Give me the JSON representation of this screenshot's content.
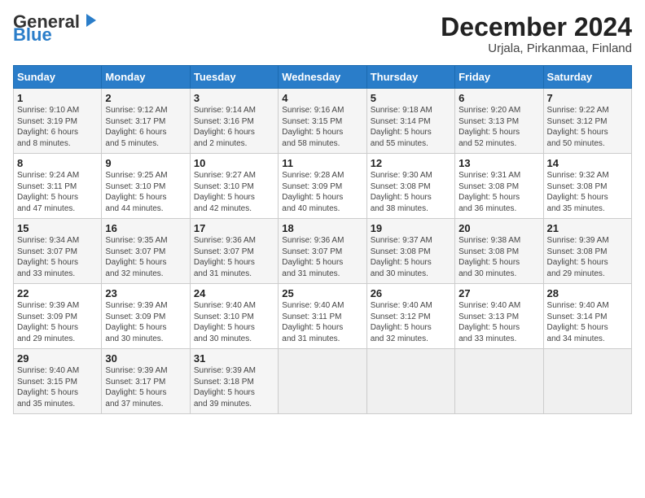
{
  "header": {
    "logo_general": "General",
    "logo_blue": "Blue",
    "title": "December 2024",
    "subtitle": "Urjala, Pirkanmaa, Finland"
  },
  "days_of_week": [
    "Sunday",
    "Monday",
    "Tuesday",
    "Wednesday",
    "Thursday",
    "Friday",
    "Saturday"
  ],
  "weeks": [
    [
      {
        "day": "1",
        "info": "Sunrise: 9:10 AM\nSunset: 3:19 PM\nDaylight: 6 hours\nand 8 minutes."
      },
      {
        "day": "2",
        "info": "Sunrise: 9:12 AM\nSunset: 3:17 PM\nDaylight: 6 hours\nand 5 minutes."
      },
      {
        "day": "3",
        "info": "Sunrise: 9:14 AM\nSunset: 3:16 PM\nDaylight: 6 hours\nand 2 minutes."
      },
      {
        "day": "4",
        "info": "Sunrise: 9:16 AM\nSunset: 3:15 PM\nDaylight: 5 hours\nand 58 minutes."
      },
      {
        "day": "5",
        "info": "Sunrise: 9:18 AM\nSunset: 3:14 PM\nDaylight: 5 hours\nand 55 minutes."
      },
      {
        "day": "6",
        "info": "Sunrise: 9:20 AM\nSunset: 3:13 PM\nDaylight: 5 hours\nand 52 minutes."
      },
      {
        "day": "7",
        "info": "Sunrise: 9:22 AM\nSunset: 3:12 PM\nDaylight: 5 hours\nand 50 minutes."
      }
    ],
    [
      {
        "day": "8",
        "info": "Sunrise: 9:24 AM\nSunset: 3:11 PM\nDaylight: 5 hours\nand 47 minutes."
      },
      {
        "day": "9",
        "info": "Sunrise: 9:25 AM\nSunset: 3:10 PM\nDaylight: 5 hours\nand 44 minutes."
      },
      {
        "day": "10",
        "info": "Sunrise: 9:27 AM\nSunset: 3:10 PM\nDaylight: 5 hours\nand 42 minutes."
      },
      {
        "day": "11",
        "info": "Sunrise: 9:28 AM\nSunset: 3:09 PM\nDaylight: 5 hours\nand 40 minutes."
      },
      {
        "day": "12",
        "info": "Sunrise: 9:30 AM\nSunset: 3:08 PM\nDaylight: 5 hours\nand 38 minutes."
      },
      {
        "day": "13",
        "info": "Sunrise: 9:31 AM\nSunset: 3:08 PM\nDaylight: 5 hours\nand 36 minutes."
      },
      {
        "day": "14",
        "info": "Sunrise: 9:32 AM\nSunset: 3:08 PM\nDaylight: 5 hours\nand 35 minutes."
      }
    ],
    [
      {
        "day": "15",
        "info": "Sunrise: 9:34 AM\nSunset: 3:07 PM\nDaylight: 5 hours\nand 33 minutes."
      },
      {
        "day": "16",
        "info": "Sunrise: 9:35 AM\nSunset: 3:07 PM\nDaylight: 5 hours\nand 32 minutes."
      },
      {
        "day": "17",
        "info": "Sunrise: 9:36 AM\nSunset: 3:07 PM\nDaylight: 5 hours\nand 31 minutes."
      },
      {
        "day": "18",
        "info": "Sunrise: 9:36 AM\nSunset: 3:07 PM\nDaylight: 5 hours\nand 31 minutes."
      },
      {
        "day": "19",
        "info": "Sunrise: 9:37 AM\nSunset: 3:08 PM\nDaylight: 5 hours\nand 30 minutes."
      },
      {
        "day": "20",
        "info": "Sunrise: 9:38 AM\nSunset: 3:08 PM\nDaylight: 5 hours\nand 30 minutes."
      },
      {
        "day": "21",
        "info": "Sunrise: 9:39 AM\nSunset: 3:08 PM\nDaylight: 5 hours\nand 29 minutes."
      }
    ],
    [
      {
        "day": "22",
        "info": "Sunrise: 9:39 AM\nSunset: 3:09 PM\nDaylight: 5 hours\nand 29 minutes."
      },
      {
        "day": "23",
        "info": "Sunrise: 9:39 AM\nSunset: 3:09 PM\nDaylight: 5 hours\nand 30 minutes."
      },
      {
        "day": "24",
        "info": "Sunrise: 9:40 AM\nSunset: 3:10 PM\nDaylight: 5 hours\nand 30 minutes."
      },
      {
        "day": "25",
        "info": "Sunrise: 9:40 AM\nSunset: 3:11 PM\nDaylight: 5 hours\nand 31 minutes."
      },
      {
        "day": "26",
        "info": "Sunrise: 9:40 AM\nSunset: 3:12 PM\nDaylight: 5 hours\nand 32 minutes."
      },
      {
        "day": "27",
        "info": "Sunrise: 9:40 AM\nSunset: 3:13 PM\nDaylight: 5 hours\nand 33 minutes."
      },
      {
        "day": "28",
        "info": "Sunrise: 9:40 AM\nSunset: 3:14 PM\nDaylight: 5 hours\nand 34 minutes."
      }
    ],
    [
      {
        "day": "29",
        "info": "Sunrise: 9:40 AM\nSunset: 3:15 PM\nDaylight: 5 hours\nand 35 minutes."
      },
      {
        "day": "30",
        "info": "Sunrise: 9:39 AM\nSunset: 3:17 PM\nDaylight: 5 hours\nand 37 minutes."
      },
      {
        "day": "31",
        "info": "Sunrise: 9:39 AM\nSunset: 3:18 PM\nDaylight: 5 hours\nand 39 minutes."
      },
      {
        "day": "",
        "info": ""
      },
      {
        "day": "",
        "info": ""
      },
      {
        "day": "",
        "info": ""
      },
      {
        "day": "",
        "info": ""
      }
    ]
  ]
}
